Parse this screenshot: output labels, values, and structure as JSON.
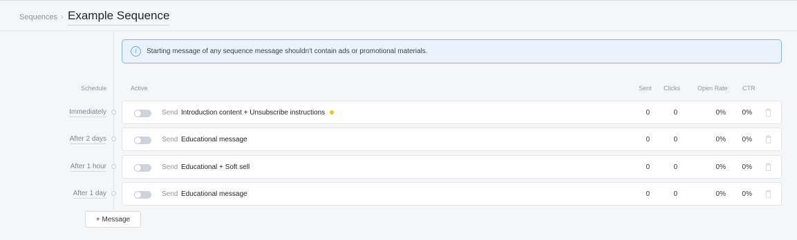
{
  "breadcrumb": {
    "parent": "Sequences",
    "separator": "›"
  },
  "page": {
    "title": "Example Sequence"
  },
  "banner": {
    "icon": "info-icon",
    "text": "Starting message of any sequence message shouldn't contain ads or promotional materials."
  },
  "columns": {
    "schedule": "Schedule",
    "active": "Active",
    "sent": "Sent",
    "clicks": "Clicks",
    "open_rate": "Open Rate",
    "ctr": "CTR"
  },
  "rows": [
    {
      "schedule": "Immediately",
      "active": false,
      "send_label": "Send",
      "name": "Introduction content + Unsubscribe instructions",
      "status_dot_color": "#f2c014",
      "sent": "0",
      "clicks": "0",
      "open_rate": "0%",
      "ctr": "0%"
    },
    {
      "schedule": "After 2 days",
      "active": false,
      "send_label": "Send",
      "name": "Educational message",
      "sent": "0",
      "clicks": "0",
      "open_rate": "0%",
      "ctr": "0%"
    },
    {
      "schedule": "After 1 hour",
      "active": false,
      "send_label": "Send",
      "name": "Educational + Soft sell",
      "sent": "0",
      "clicks": "0",
      "open_rate": "0%",
      "ctr": "0%"
    },
    {
      "schedule": "After 1 day",
      "active": false,
      "send_label": "Send",
      "name": "Educational message",
      "sent": "0",
      "clicks": "0",
      "open_rate": "0%",
      "ctr": "0%"
    }
  ],
  "add_button": {
    "label": "+ Message"
  },
  "colors": {
    "accent": "#7fb4ea",
    "banner_bg": "#eaf3fd",
    "status_dot": "#f2c014"
  }
}
